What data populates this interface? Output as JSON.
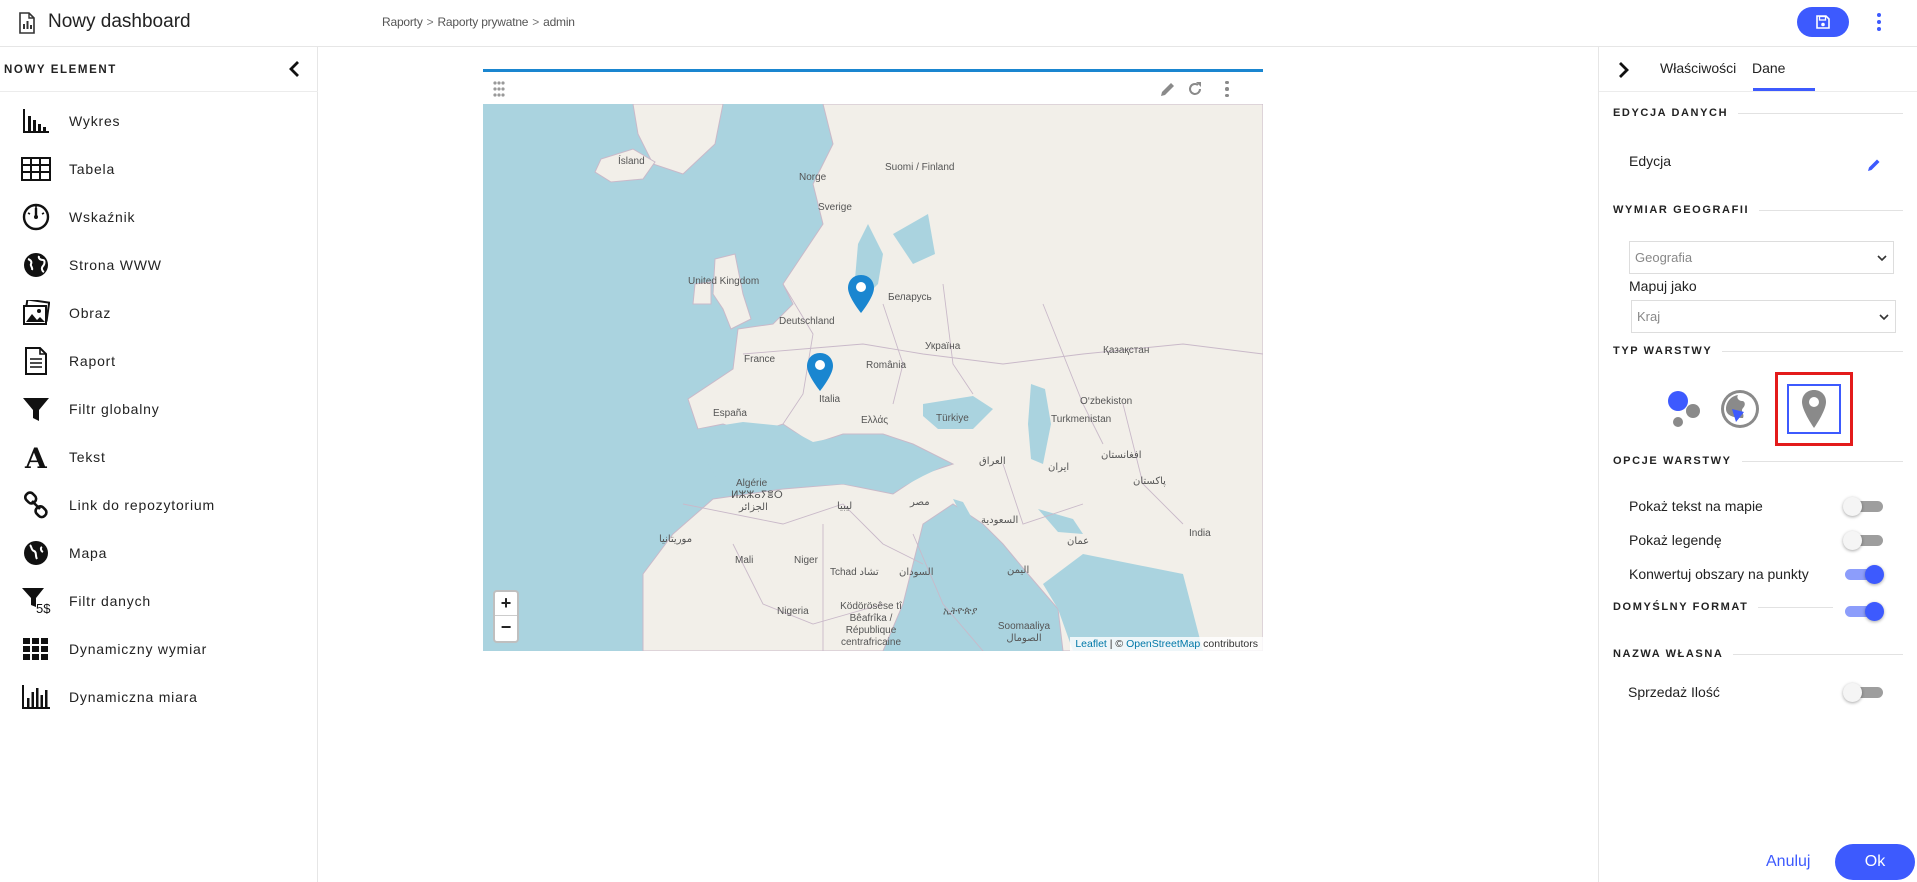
{
  "header": {
    "title": "Nowy dashboard",
    "breadcrumb": [
      "Raporty",
      "Raporty prywatne",
      "admin"
    ],
    "breadcrumb_sep": ">",
    "save_icon": "save-icon",
    "menu_icon": "more-vert-icon",
    "accent": "#3d5afe"
  },
  "left_panel": {
    "heading": "NOWY ELEMENT",
    "collapse_icon": "chevron-left-icon",
    "items": [
      {
        "label": "Wykres",
        "icon": "bar-chart-icon"
      },
      {
        "label": "Tabela",
        "icon": "table-icon"
      },
      {
        "label": "Wskaźnik",
        "icon": "gauge-icon"
      },
      {
        "label": "Strona WWW",
        "icon": "globe-icon"
      },
      {
        "label": "Obraz",
        "icon": "image-icon"
      },
      {
        "label": "Raport",
        "icon": "document-icon"
      },
      {
        "label": "Filtr globalny",
        "icon": "funnel-icon"
      },
      {
        "label": "Tekst",
        "icon": "text-icon"
      },
      {
        "label": "Link do repozytorium",
        "icon": "link-icon"
      },
      {
        "label": "Mapa",
        "icon": "map-globe-icon"
      },
      {
        "label": "Filtr danych",
        "icon": "data-filter-icon",
        "badge": "5$"
      },
      {
        "label": "Dynamiczny wymiar",
        "icon": "grid-icon"
      },
      {
        "label": "Dynamiczna miara",
        "icon": "measure-chart-icon"
      }
    ]
  },
  "widget": {
    "toolbar_icons": [
      "drag-handle-icon",
      "edit-icon",
      "refresh-icon",
      "more-vert-icon"
    ],
    "map": {
      "labels": [
        "Ísland",
        "Norge",
        "Suomi / Finland",
        "Sverige",
        "United Kingdom",
        "Беларусь",
        "Deutschland",
        "Україна",
        "France",
        "România",
        "Қазақстан",
        "Italia",
        "España",
        "Ελλάς",
        "Türkiye",
        "O‘zbekiston",
        "Turkmenistan",
        "العراق",
        "ایران",
        "افغانستان",
        "Algérie",
        "ⵍⵣⵣⴰⵢⴻⵔ",
        "الجزائر",
        "ليبيا",
        "مصر",
        "السعودية",
        "پاکستان",
        "India",
        "موريتانيا",
        "Mali",
        "Niger",
        "Tchad تشاد",
        "السودان",
        "اليمن",
        "عمان",
        "Nigeria",
        "Ködörösêse tî Bêafrîka / République centrafricaine",
        "ኢትዮጵያ",
        "Soomaaliya الصومال"
      ],
      "zoom_in": "+",
      "zoom_out": "−",
      "attribution_leaflet": "Leaflet",
      "attribution_sep": " | © ",
      "attribution_osm": "OpenStreetMap",
      "attribution_tail": " contributors",
      "markers": [
        "marker-poland",
        "marker-italy"
      ],
      "marker_color": "#1a86d0"
    }
  },
  "right_panel": {
    "expand_icon": "chevron-right-icon",
    "tabs": [
      "Właściwości",
      "Dane"
    ],
    "active_tab": "Dane",
    "section_data_edit": "EDYCJA DANYCH",
    "edit_label": "Edycja",
    "section_geo": "WYMIAR GEOGRAFII",
    "geo_select": "Geografia",
    "map_as_label": "Mapuj jako",
    "map_as_select": "Kraj",
    "section_layer_type": "TYP WARSTWY",
    "layer_types": [
      "bubbles-icon",
      "choropleth-globe-icon",
      "pin-marker-icon"
    ],
    "active_layer_type": "pin-marker-icon",
    "section_layer_options": "OPCJE WARSTWY",
    "options": [
      {
        "label": "Pokaż tekst na mapie",
        "on": false
      },
      {
        "label": "Pokaż legendę",
        "on": false
      },
      {
        "label": "Konwertuj obszary na punkty",
        "on": true
      }
    ],
    "section_default_format": "DOMYŚLNY FORMAT",
    "default_format_on": true,
    "section_custom_name": "NAZWA WŁASNA",
    "custom_name_label": "Sprzedaż Ilość",
    "custom_name_on": false,
    "cancel_label": "Anuluj",
    "ok_label": "Ok",
    "highlight_color": "#e31b1b"
  }
}
